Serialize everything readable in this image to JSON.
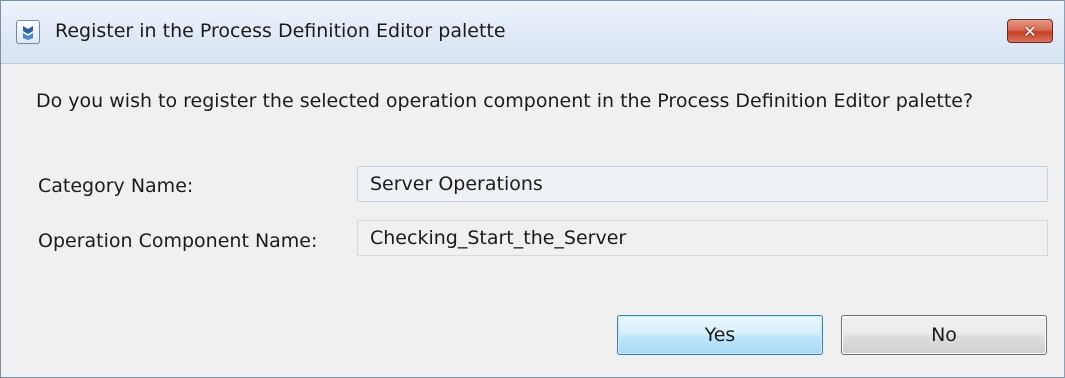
{
  "window": {
    "title": "Register in the Process Definition Editor palette",
    "close_glyph": "✕"
  },
  "dialog": {
    "question": "Do you wish to register the selected operation component in the Process Definition Editor palette?",
    "category_label": "Category Name:",
    "category_value": "Server Operations",
    "operation_label": "Operation Component Name:",
    "operation_value": "Checking_Start_the_Server"
  },
  "buttons": {
    "yes_label": "Yes",
    "no_label": "No"
  },
  "icons": {
    "app": "app-icon",
    "close": "close-icon"
  },
  "colors": {
    "yes_border": "#3c7fb1",
    "close_red": "#c7412a"
  }
}
